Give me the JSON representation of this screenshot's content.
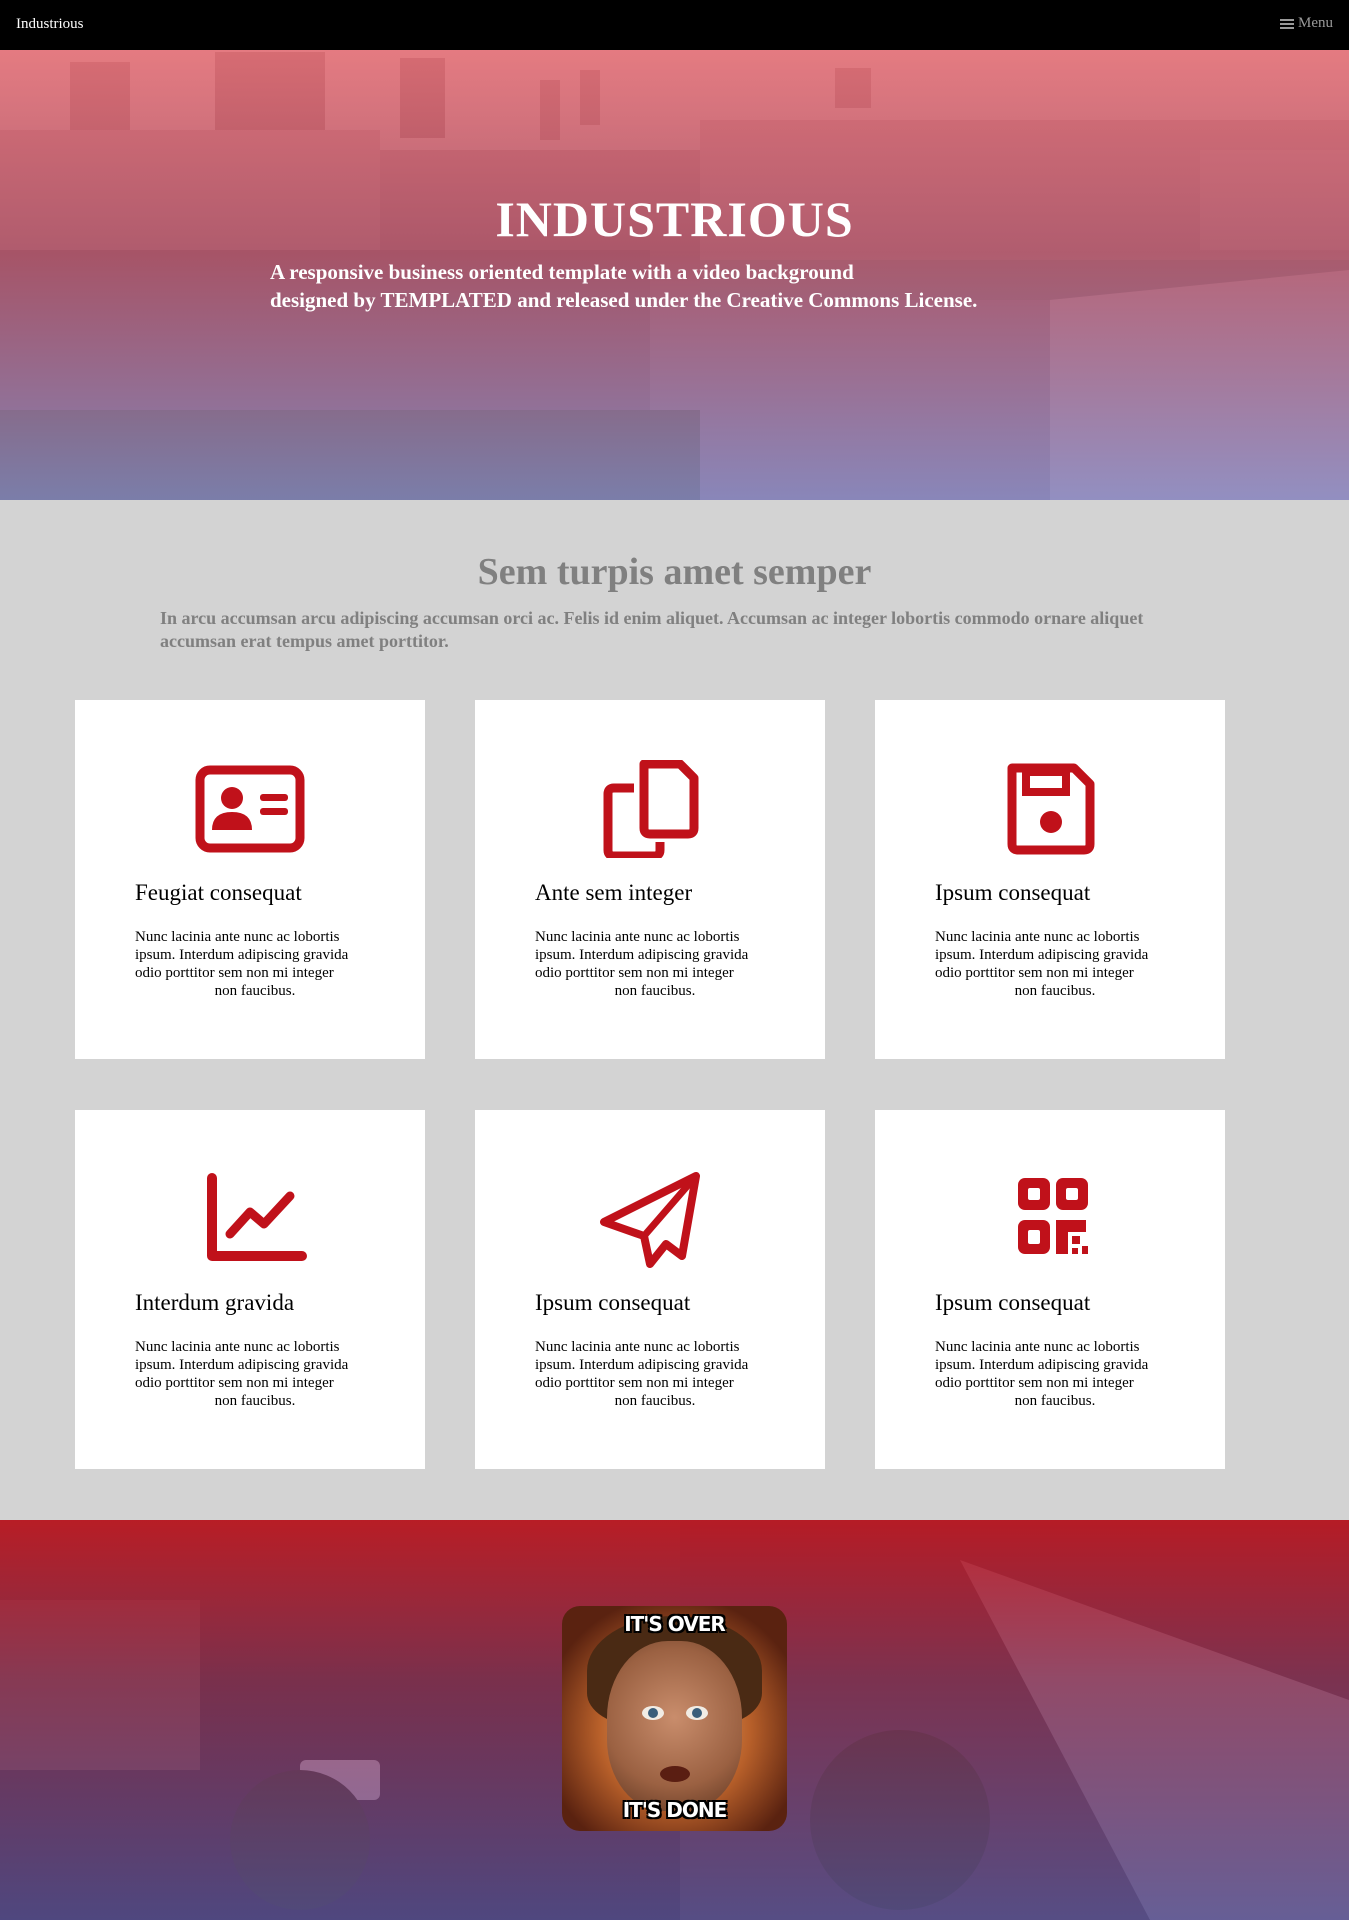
{
  "nav": {
    "brand": "Industrious",
    "menu_label": "Menu"
  },
  "hero": {
    "title": "INDUSTRIOUS",
    "subtitle_line1": "A responsive business oriented template with a video background",
    "subtitle_line2": "designed by TEMPLATED and released under the Creative Commons License."
  },
  "intro": {
    "title": "Sem turpis amet semper",
    "text": "In arcu accumsan arcu adipiscing accumsan orci ac. Felis id enim aliquet. Accumsan ac integer lobortis commodo ornare aliquet accumsan erat tempus amet porttitor."
  },
  "cards": [
    {
      "title": "Feugiat consequat",
      "icon": "id-card-icon",
      "text_lines": [
        "Nunc lacinia ante nunc ac lobortis",
        "ipsum. Interdum adipiscing gravida",
        "odio porttitor sem non mi integer",
        "non faucibus."
      ]
    },
    {
      "title": "Ante sem integer",
      "icon": "copy-icon",
      "text_lines": [
        "Nunc lacinia ante nunc ac lobortis",
        "ipsum. Interdum adipiscing gravida",
        "odio porttitor sem non mi integer",
        "non faucibus."
      ]
    },
    {
      "title": "Ipsum consequat",
      "icon": "save-icon",
      "text_lines": [
        "Nunc lacinia ante nunc ac lobortis",
        "ipsum. Interdum adipiscing gravida",
        "odio porttitor sem non mi integer",
        "non faucibus."
      ]
    },
    {
      "title": "Interdum gravida",
      "icon": "line-chart-icon",
      "text_lines": [
        "Nunc lacinia ante nunc ac lobortis",
        "ipsum. Interdum adipiscing gravida",
        "odio porttitor sem non mi integer",
        "non faucibus."
      ]
    },
    {
      "title": "Ipsum consequat",
      "icon": "paper-plane-icon",
      "text_lines": [
        "Nunc lacinia ante nunc ac lobortis",
        "ipsum. Interdum adipiscing gravida",
        "odio porttitor sem non mi integer",
        "non faucibus."
      ]
    },
    {
      "title": "Ipsum consequat",
      "icon": "qr-code-icon",
      "text_lines": [
        "Nunc lacinia ante nunc ac lobortis",
        "ipsum. Interdum adipiscing gravida",
        "odio porttitor sem non mi integer",
        "non faucibus."
      ]
    }
  ],
  "meme": {
    "top_text": "IT'S OVER",
    "bottom_text": "IT'S DONE"
  },
  "colors": {
    "accent": "#c0111a",
    "nav_bg": "#000000",
    "section_bg": "#d3d3d3",
    "muted_text": "#808080"
  }
}
